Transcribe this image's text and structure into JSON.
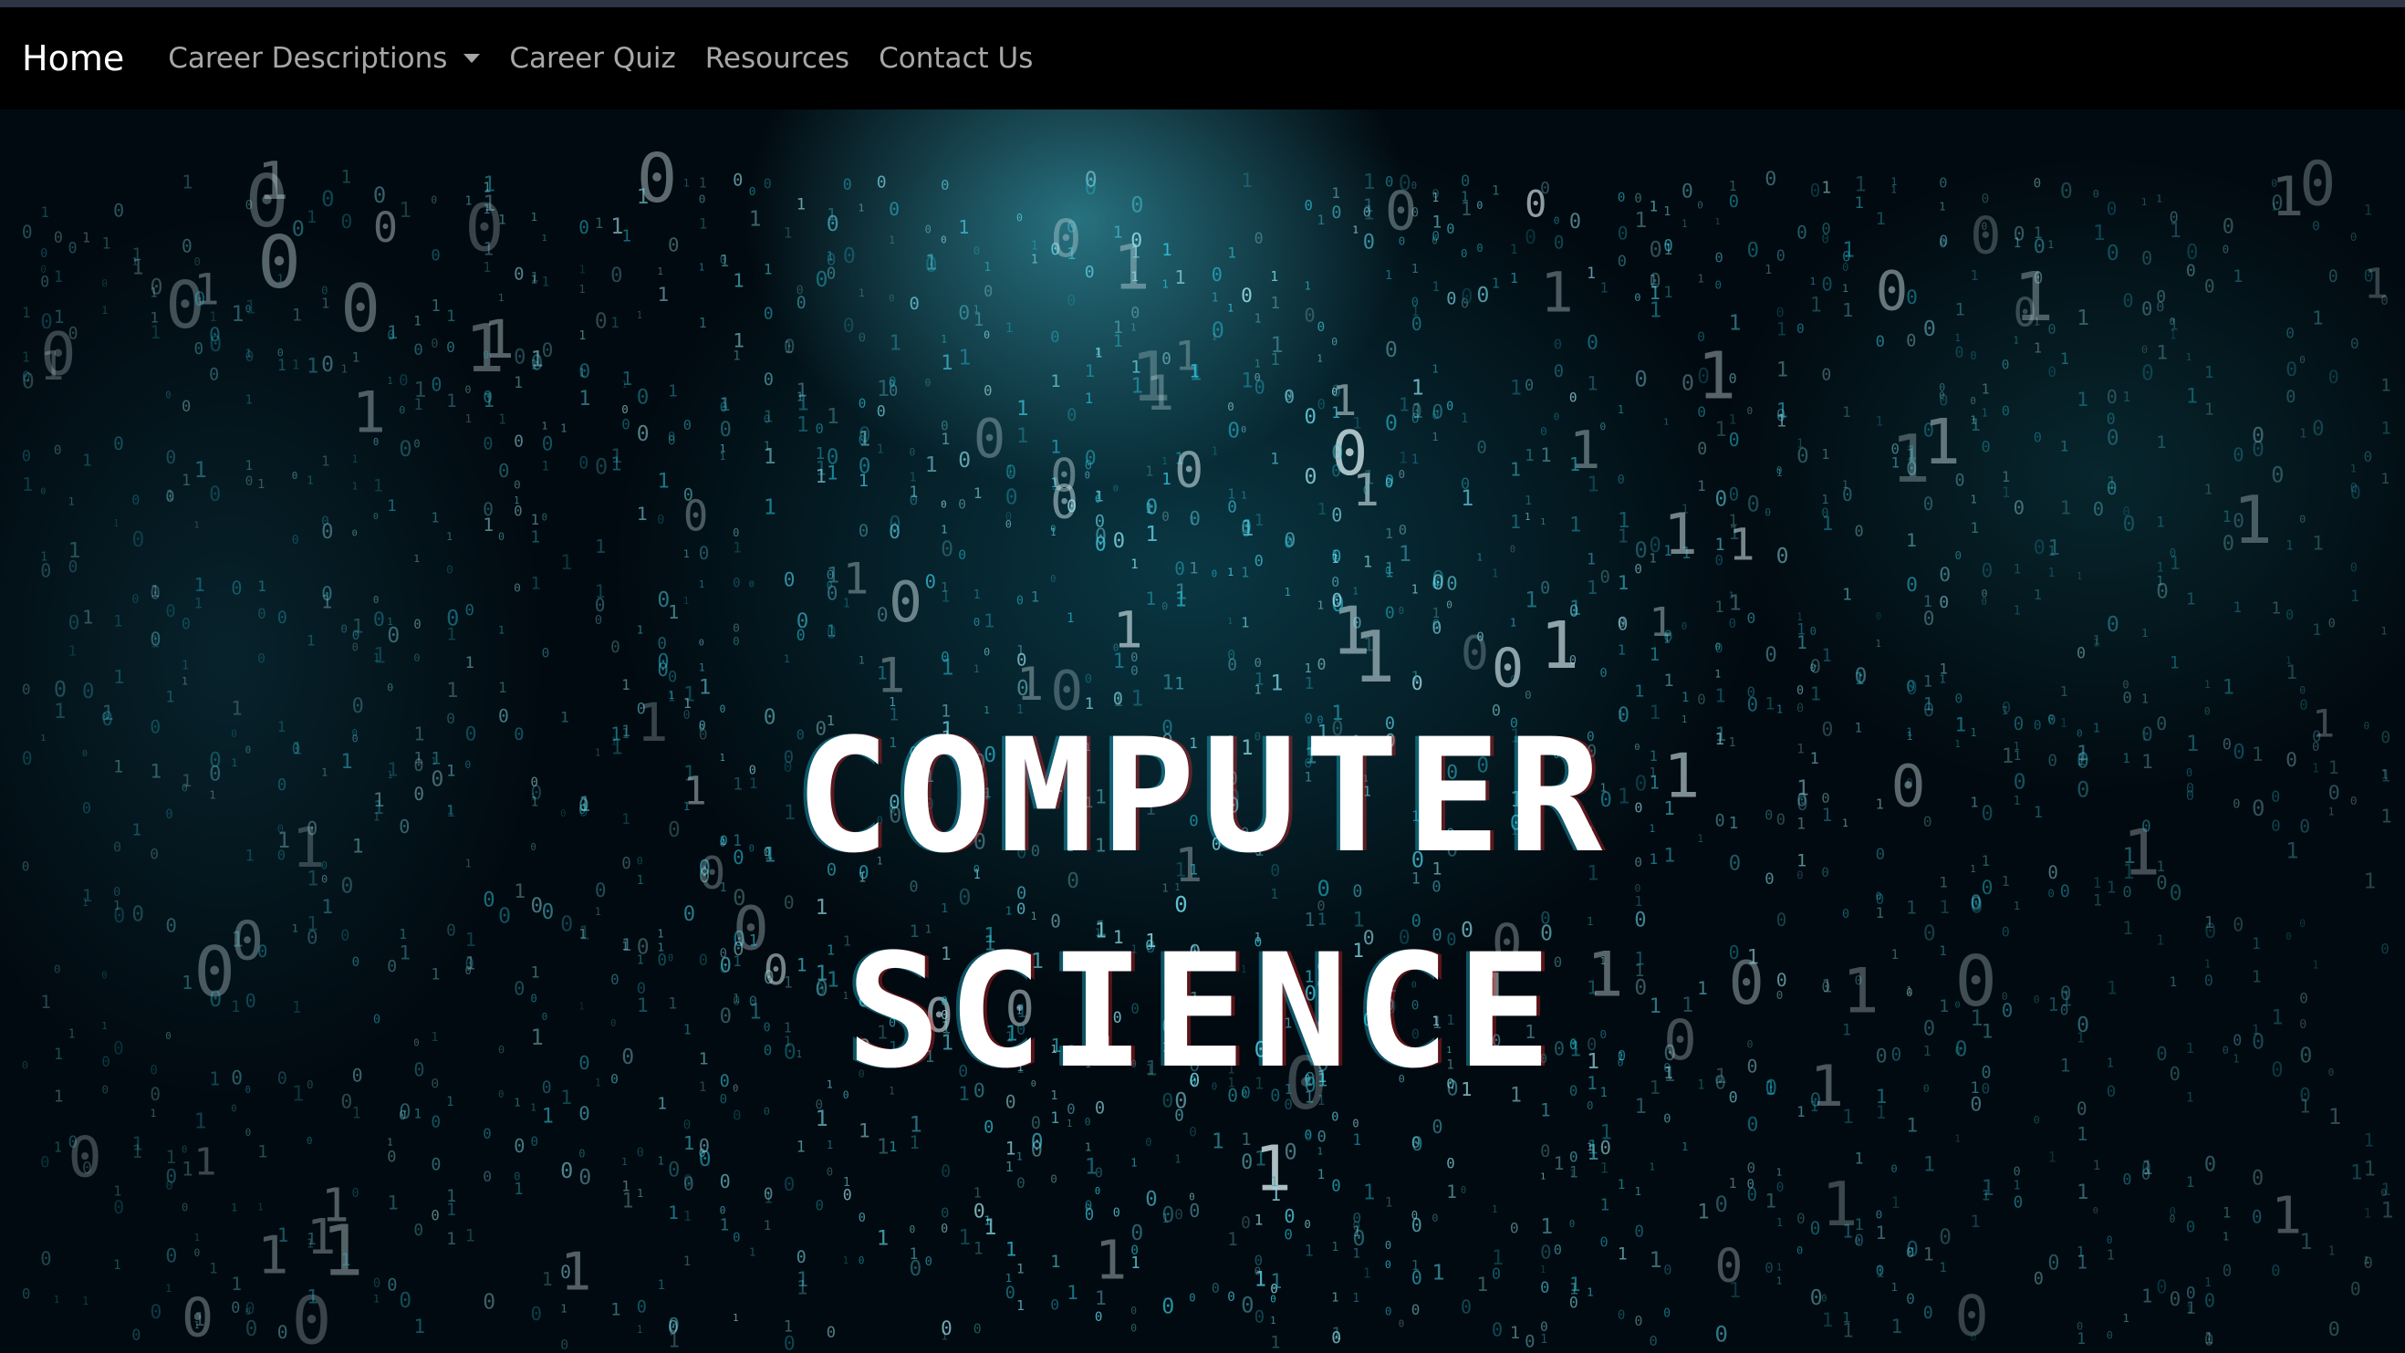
{
  "navbar": {
    "brand": "Home",
    "items": [
      {
        "label": "Career Descriptions",
        "dropdown": true
      },
      {
        "label": "Career Quiz"
      },
      {
        "label": "Resources"
      },
      {
        "label": "Contact Us"
      }
    ]
  },
  "hero": {
    "title_line1": "COMPUTER",
    "title_line2": "SCIENCE",
    "background": "binary-rain-image"
  },
  "colors": {
    "navbar_bg": "#000000",
    "top_line": "#2c3446",
    "nav_text": "#a7a7a7",
    "brand_text": "#ffffff",
    "accent_teal": "#3fb8c8"
  }
}
